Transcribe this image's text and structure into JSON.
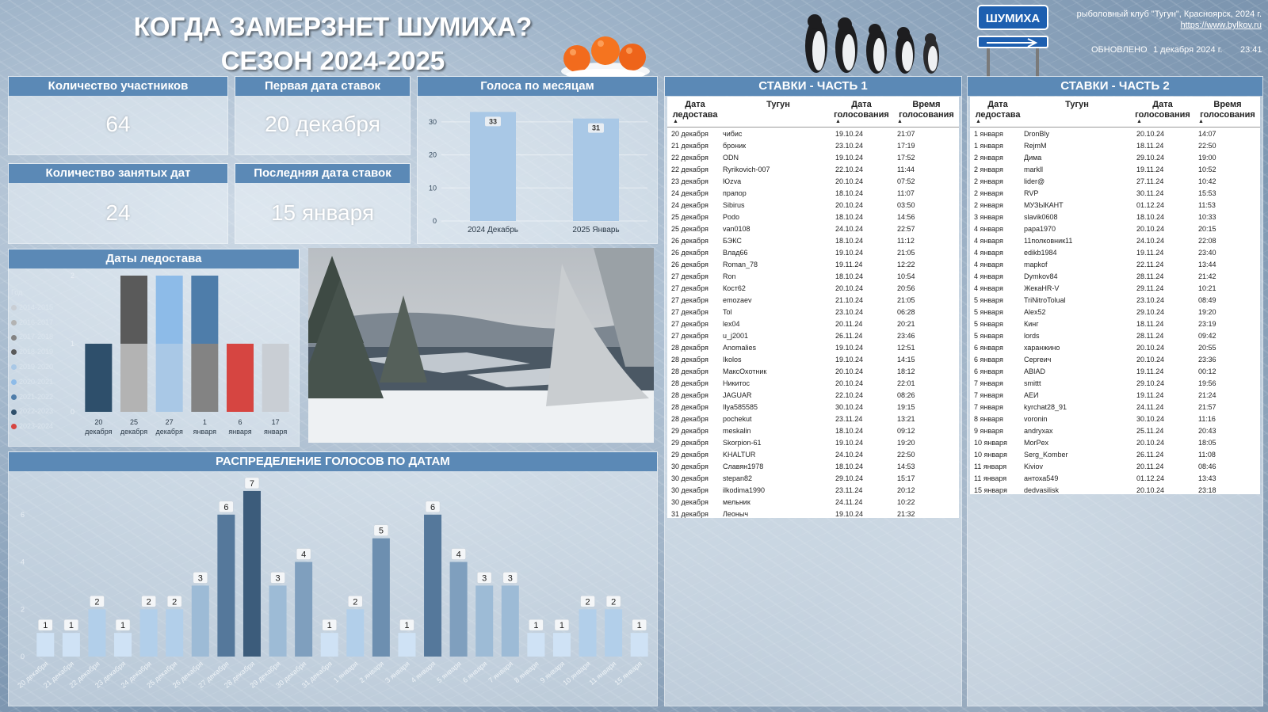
{
  "title": {
    "line1": "КОГДА ЗАМЕРЗНЕТ ШУМИХА?",
    "line2": "СЕЗОН 2024-2025"
  },
  "sign": {
    "label": "ШУМИХА"
  },
  "club": {
    "name": "рыболовный клуб \"Тугун\", Красноярск, 2024 г.",
    "url": "https://www.bylkov.ru"
  },
  "updated": {
    "label": "ОБНОВЛЕНО",
    "date": "1 декабря 2024 г.",
    "time": "23:41"
  },
  "kpi": {
    "participants": {
      "label": "Количество участников",
      "value": "64"
    },
    "first_date": {
      "label": "Первая дата ставок",
      "value": "20 декабря"
    },
    "occupied": {
      "label": "Количество занятых дат",
      "value": "24"
    },
    "last_date": {
      "label": "Последняя дата ставок",
      "value": "15 января"
    }
  },
  "votes_month": {
    "title": "Голоса по месяцам",
    "chart_data": {
      "type": "bar",
      "categories": [
        "2024 Декабрь",
        "2025 Январь"
      ],
      "values": [
        33,
        31
      ],
      "yticks": [
        0,
        10,
        20,
        30
      ],
      "ylim": [
        0,
        35
      ],
      "color": "#a9c8e6"
    }
  },
  "ice_dates": {
    "title": "Даты ледостава",
    "legend_title": "Год",
    "chart_data": {
      "type": "bar",
      "stacked": true,
      "categories": [
        "20 декабря",
        "25 декабря",
        "27 декабря",
        "1 января",
        "6 января",
        "17 января"
      ],
      "series": [
        {
          "name": "2014-2015",
          "color": "#c9ced4",
          "values": [
            0,
            0,
            0,
            0,
            0,
            1
          ]
        },
        {
          "name": "2016-2017",
          "color": "#b3b3b3",
          "values": [
            0,
            1,
            0,
            0,
            0,
            0
          ]
        },
        {
          "name": "2017-2018",
          "color": "#838383",
          "values": [
            0,
            0,
            0,
            1,
            0,
            0
          ]
        },
        {
          "name": "2018-2019",
          "color": "#5a5a5a",
          "values": [
            0,
            1,
            0,
            0,
            0,
            0
          ]
        },
        {
          "name": "2019-2020",
          "color": "#a9c8e6",
          "values": [
            0,
            0,
            1,
            0,
            0,
            0
          ]
        },
        {
          "name": "2020-2021",
          "color": "#8dbbe8",
          "values": [
            0,
            0,
            1,
            0,
            0,
            0
          ]
        },
        {
          "name": "2021-2022",
          "color": "#4e7daa",
          "values": [
            0,
            0,
            0,
            1,
            0,
            0
          ]
        },
        {
          "name": "2022-2023",
          "color": "#2e4f6b",
          "values": [
            1,
            0,
            0,
            0,
            0,
            0
          ]
        },
        {
          "name": "2023-2024",
          "color": "#d64541",
          "values": [
            0,
            0,
            0,
            0,
            1,
            0
          ]
        }
      ],
      "yticks": [
        0,
        1,
        2
      ],
      "ylim": [
        0,
        2
      ]
    }
  },
  "distribution": {
    "title": "РАСПРЕДЕЛЕНИЕ ГОЛОСОВ ПО ДАТАМ",
    "chart_data": {
      "type": "bar",
      "categories": [
        "20 декабря",
        "21 декабря",
        "22 декабря",
        "23 декабря",
        "24 декабря",
        "25 декабря",
        "26 декабря",
        "27 декабря",
        "28 декабря",
        "29 декабря",
        "30 декабря",
        "31 декабря",
        "1 января",
        "2 января",
        "3 января",
        "4 января",
        "5 января",
        "6 января",
        "7 января",
        "8 января",
        "9 января",
        "10 января",
        "11 января",
        "15 января"
      ],
      "values": [
        1,
        1,
        2,
        1,
        2,
        2,
        3,
        6,
        7,
        3,
        4,
        1,
        2,
        5,
        1,
        6,
        4,
        3,
        3,
        1,
        1,
        2,
        2,
        1
      ],
      "yticks": [
        0,
        2,
        4,
        6
      ],
      "ylim": [
        0,
        7.5
      ]
    }
  },
  "bets1": {
    "title": "СТАВКИ - ЧАСТЬ 1",
    "columns": [
      "Дата ледостава",
      "Тугун",
      "Дата голосования",
      "Время голосования"
    ],
    "rows": [
      [
        "20 декабря",
        "чибис",
        "19.10.24",
        "21:07"
      ],
      [
        "21 декабря",
        "бpоник",
        "23.10.24",
        "17:19"
      ],
      [
        "22 декабря",
        "ODN",
        "19.10.24",
        "17:52"
      ],
      [
        "22 декабря",
        "Ryrikovich-007",
        "22.10.24",
        "11:44"
      ],
      [
        "23 декабря",
        "Юzva",
        "20.10.24",
        "07:52"
      ],
      [
        "24 декабря",
        "прапор",
        "18.10.24",
        "11:07"
      ],
      [
        "24 декабря",
        "Sibirus",
        "20.10.24",
        "03:50"
      ],
      [
        "25 декабря",
        "Podo",
        "18.10.24",
        "14:56"
      ],
      [
        "25 декабря",
        "van0108",
        "24.10.24",
        "22:57"
      ],
      [
        "26 декабря",
        "БЭКС",
        "18.10.24",
        "11:12"
      ],
      [
        "26 декабря",
        "Влад66",
        "19.10.24",
        "21:05"
      ],
      [
        "26 декабря",
        "Roman_78",
        "19.11.24",
        "12:22"
      ],
      [
        "27 декабря",
        "Ron",
        "18.10.24",
        "10:54"
      ],
      [
        "27 декабря",
        "Кост62",
        "20.10.24",
        "20:56"
      ],
      [
        "27 декабря",
        "emozaev",
        "21.10.24",
        "21:05"
      ],
      [
        "27 декабря",
        "Tol",
        "23.10.24",
        "06:28"
      ],
      [
        "27 декабря",
        "lex04",
        "20.11.24",
        "20:21"
      ],
      [
        "27 декабря",
        "u_j2001",
        "26.11.24",
        "23:46"
      ],
      [
        "28 декабря",
        "Anomalies",
        "19.10.24",
        "12:51"
      ],
      [
        "28 декабря",
        "Ikolos",
        "19.10.24",
        "14:15"
      ],
      [
        "28 декабря",
        "МаксОхотник",
        "20.10.24",
        "18:12"
      ],
      [
        "28 декабря",
        "Никитос",
        "20.10.24",
        "22:01"
      ],
      [
        "28 декабря",
        "JAGUAR",
        "22.10.24",
        "08:26"
      ],
      [
        "28 декабря",
        "Ilya585585",
        "30.10.24",
        "19:15"
      ],
      [
        "28 декабря",
        "pochekut",
        "23.11.24",
        "13:21"
      ],
      [
        "29 декабря",
        "meskalin",
        "18.10.24",
        "09:12"
      ],
      [
        "29 декабря",
        "Skorpion-61",
        "19.10.24",
        "19:20"
      ],
      [
        "29 декабря",
        "KHALTUR",
        "24.10.24",
        "22:50"
      ],
      [
        "30 декабря",
        "Славян1978",
        "18.10.24",
        "14:53"
      ],
      [
        "30 декабря",
        "stepan82",
        "29.10.24",
        "15:17"
      ],
      [
        "30 декабря",
        "ilkodima1990",
        "23.11.24",
        "20:12"
      ],
      [
        "30 декабря",
        "мельник",
        "24.11.24",
        "10:22"
      ],
      [
        "31 декабря",
        "Леоныч",
        "19.10.24",
        "21:32"
      ]
    ]
  },
  "bets2": {
    "title": "СТАВКИ - ЧАСТЬ 2",
    "columns": [
      "Дата ледостава",
      "Тугун",
      "Дата голосования",
      "Время голосования"
    ],
    "rows": [
      [
        "1 января",
        "DronBly",
        "20.10.24",
        "14:07"
      ],
      [
        "1 января",
        "RejmM",
        "18.11.24",
        "22:50"
      ],
      [
        "2 января",
        "Дима",
        "29.10.24",
        "19:00"
      ],
      [
        "2 января",
        "markll",
        "19.11.24",
        "10:52"
      ],
      [
        "2 января",
        "lider@",
        "27.11.24",
        "10:42"
      ],
      [
        "2 января",
        "RVP",
        "30.11.24",
        "15:53"
      ],
      [
        "2 января",
        "МУЗЫКАНТ",
        "01.12.24",
        "11:53"
      ],
      [
        "3 января",
        "slavik0608",
        "18.10.24",
        "10:33"
      ],
      [
        "4 января",
        "papa1970",
        "20.10.24",
        "20:15"
      ],
      [
        "4 января",
        "11полковник11",
        "24.10.24",
        "22:08"
      ],
      [
        "4 января",
        "edikb1984",
        "19.11.24",
        "23:40"
      ],
      [
        "4 января",
        "mapkof",
        "22.11.24",
        "13:44"
      ],
      [
        "4 января",
        "Dymkov84",
        "28.11.24",
        "21:42"
      ],
      [
        "4 января",
        "ЖекаHR-V",
        "29.11.24",
        "10:21"
      ],
      [
        "5 января",
        "TriNitroTolual",
        "23.10.24",
        "08:49"
      ],
      [
        "5 января",
        "Alex52",
        "29.10.24",
        "19:20"
      ],
      [
        "5 января",
        "Кинг",
        "18.11.24",
        "23:19"
      ],
      [
        "5 января",
        "lords",
        "28.11.24",
        "09:42"
      ],
      [
        "6 января",
        "харанжино",
        "20.10.24",
        "20:55"
      ],
      [
        "6 января",
        "Сергеич",
        "20.10.24",
        "23:36"
      ],
      [
        "6 января",
        "ABIAD",
        "19.11.24",
        "00:12"
      ],
      [
        "7 января",
        "smittt",
        "29.10.24",
        "19:56"
      ],
      [
        "7 января",
        "АЕИ",
        "19.11.24",
        "21:24"
      ],
      [
        "7 января",
        "kyrchat28_91",
        "24.11.24",
        "21:57"
      ],
      [
        "8 января",
        "voronin",
        "30.10.24",
        "11:16"
      ],
      [
        "9 января",
        "andryxax",
        "25.11.24",
        "20:43"
      ],
      [
        "10 января",
        "MorPex",
        "20.10.24",
        "18:05"
      ],
      [
        "10 января",
        "Serg_Komber",
        "26.11.24",
        "11:08"
      ],
      [
        "11 января",
        "Kiviov",
        "20.11.24",
        "08:46"
      ],
      [
        "11 января",
        "антоха549",
        "01.12.24",
        "13:43"
      ],
      [
        "15 января",
        "dedvasilisk",
        "20.10.24",
        "23:18"
      ]
    ]
  }
}
